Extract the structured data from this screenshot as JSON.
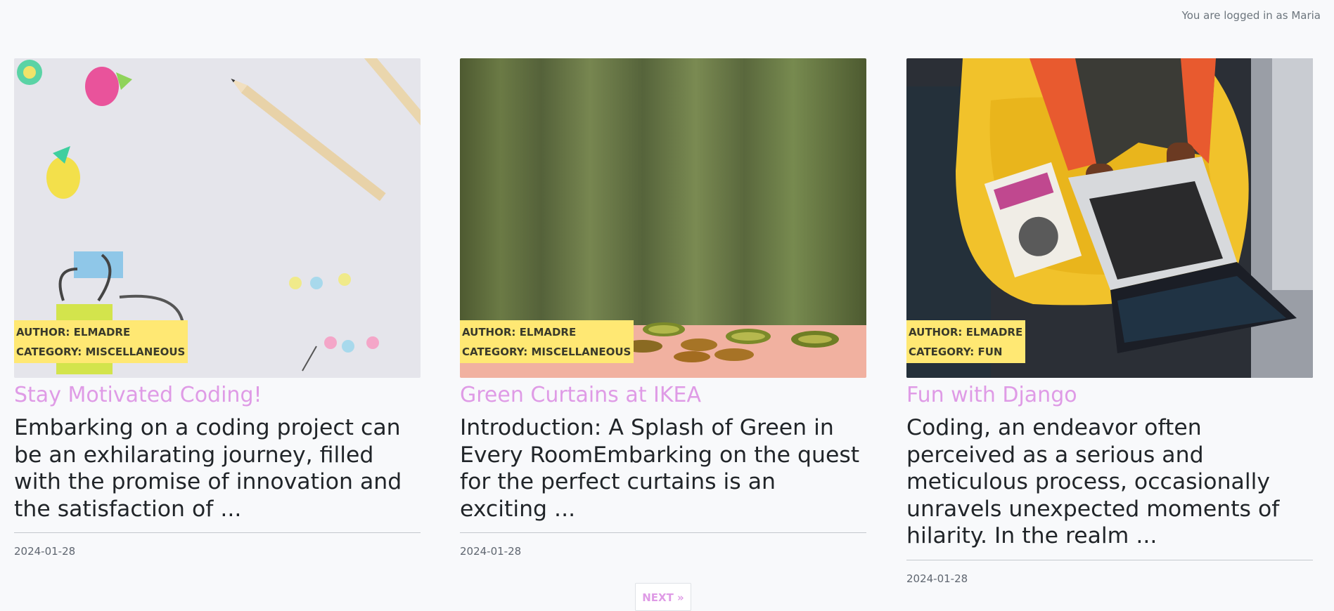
{
  "header": {
    "login_status": "You are logged in as Maria"
  },
  "posts": [
    {
      "image": "desk-supplies-photo",
      "author": "AUTHOR: ELMADRE",
      "category": "CATEGORY: MISCELLANEOUS",
      "title": "Stay Motivated Coding!",
      "excerpt": "Embarking on a coding project can be an exhilarating journey, filled with the promise of innovation and the satisfaction of ...",
      "date": "2024-01-28"
    },
    {
      "image": "green-curtains-kiwi-photo",
      "author": "AUTHOR: ELMADRE",
      "category": "CATEGORY: MISCELLANEOUS",
      "title": "Green Curtains at IKEA",
      "excerpt": "Introduction: A Splash of Green in Every RoomEmbarking on the quest for the perfect curtains is an exciting ...",
      "date": "2024-01-28"
    },
    {
      "image": "laptop-python-book-photo",
      "author": "AUTHOR: ELMADRE",
      "category": "CATEGORY: FUN",
      "title": "Fun with Django",
      "excerpt": "Coding, an endeavor often perceived as a serious and meticulous process, occasionally unravels unexpected moments of hilarity. In the realm ...",
      "date": "2024-01-28"
    }
  ],
  "pagination": {
    "next_label": "NEXT »"
  },
  "colors": {
    "accent": "#df9be6",
    "badge": "#ffe873",
    "background": "#f8f9fb"
  }
}
